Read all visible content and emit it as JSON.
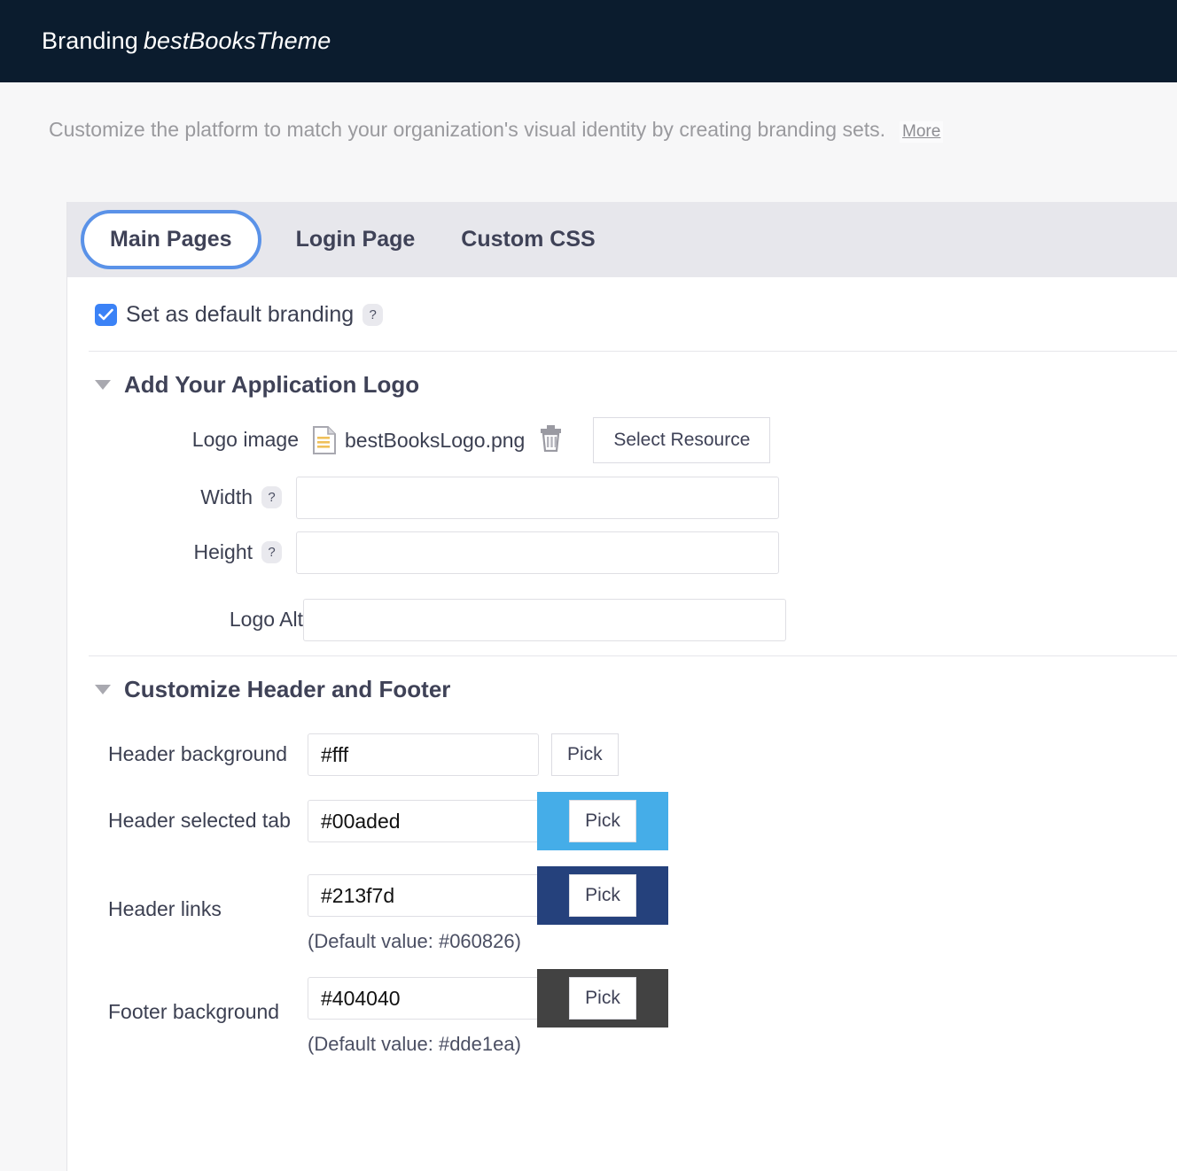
{
  "header": {
    "title_prefix": "Branding",
    "theme_name": "bestBooksTheme",
    "bg_color": "#0b1c2e"
  },
  "description": {
    "text": "Customize the platform to match your organization's visual identity by creating branding sets.",
    "more_label": "More"
  },
  "tabs": [
    {
      "label": "Main Pages",
      "active": true
    },
    {
      "label": "Login Page",
      "active": false
    },
    {
      "label": "Custom CSS",
      "active": false
    }
  ],
  "default_branding": {
    "label": "Set as default branding",
    "checked": true,
    "help": "?"
  },
  "logo_section": {
    "title": "Add Your Application Logo",
    "logo_image": {
      "label": "Logo image",
      "file_name": "bestBooksLogo.png",
      "select_button": "Select Resource"
    },
    "fields": [
      {
        "label": "Width",
        "help": "?",
        "value": "",
        "placeholder": ""
      },
      {
        "label": "Height",
        "help": "?",
        "value": "",
        "placeholder": ""
      },
      {
        "label": "Logo Alt",
        "help": "",
        "value": "",
        "placeholder": ""
      }
    ]
  },
  "header_footer_section": {
    "title": "Customize Header and Footer",
    "colors": [
      {
        "label": "Header background",
        "value": "#fff",
        "pick_label": "Pick",
        "swatch_color": "#ffffff",
        "show_swatch": false,
        "default_hint": ""
      },
      {
        "label": "Header selected tab",
        "value": "#00aded",
        "pick_label": "Pick",
        "swatch_color": "#45ade8",
        "show_swatch": true,
        "default_hint": ""
      },
      {
        "label": "Header links",
        "value": "#213f7d",
        "pick_label": "Pick",
        "swatch_color": "#25417c",
        "show_swatch": true,
        "default_hint": "(Default value: #060826)"
      },
      {
        "label": "Footer background",
        "value": "#404040",
        "pick_label": "Pick",
        "swatch_color": "#424242",
        "show_swatch": true,
        "default_hint": "(Default value: #dde1ea)"
      }
    ]
  }
}
